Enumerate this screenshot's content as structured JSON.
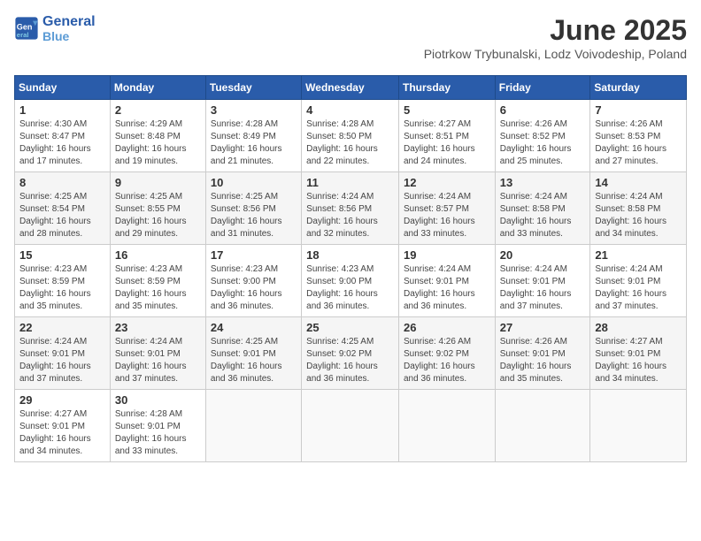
{
  "header": {
    "logo_line1": "General",
    "logo_line2": "Blue",
    "month_title": "June 2025",
    "location": "Piotrkow Trybunalski, Lodz Voivodeship, Poland"
  },
  "columns": [
    "Sunday",
    "Monday",
    "Tuesday",
    "Wednesday",
    "Thursday",
    "Friday",
    "Saturday"
  ],
  "weeks": [
    [
      {
        "day": "1",
        "info": "Sunrise: 4:30 AM\nSunset: 8:47 PM\nDaylight: 16 hours\nand 17 minutes."
      },
      {
        "day": "2",
        "info": "Sunrise: 4:29 AM\nSunset: 8:48 PM\nDaylight: 16 hours\nand 19 minutes."
      },
      {
        "day": "3",
        "info": "Sunrise: 4:28 AM\nSunset: 8:49 PM\nDaylight: 16 hours\nand 21 minutes."
      },
      {
        "day": "4",
        "info": "Sunrise: 4:28 AM\nSunset: 8:50 PM\nDaylight: 16 hours\nand 22 minutes."
      },
      {
        "day": "5",
        "info": "Sunrise: 4:27 AM\nSunset: 8:51 PM\nDaylight: 16 hours\nand 24 minutes."
      },
      {
        "day": "6",
        "info": "Sunrise: 4:26 AM\nSunset: 8:52 PM\nDaylight: 16 hours\nand 25 minutes."
      },
      {
        "day": "7",
        "info": "Sunrise: 4:26 AM\nSunset: 8:53 PM\nDaylight: 16 hours\nand 27 minutes."
      }
    ],
    [
      {
        "day": "8",
        "info": "Sunrise: 4:25 AM\nSunset: 8:54 PM\nDaylight: 16 hours\nand 28 minutes."
      },
      {
        "day": "9",
        "info": "Sunrise: 4:25 AM\nSunset: 8:55 PM\nDaylight: 16 hours\nand 29 minutes."
      },
      {
        "day": "10",
        "info": "Sunrise: 4:25 AM\nSunset: 8:56 PM\nDaylight: 16 hours\nand 31 minutes."
      },
      {
        "day": "11",
        "info": "Sunrise: 4:24 AM\nSunset: 8:56 PM\nDaylight: 16 hours\nand 32 minutes."
      },
      {
        "day": "12",
        "info": "Sunrise: 4:24 AM\nSunset: 8:57 PM\nDaylight: 16 hours\nand 33 minutes."
      },
      {
        "day": "13",
        "info": "Sunrise: 4:24 AM\nSunset: 8:58 PM\nDaylight: 16 hours\nand 33 minutes."
      },
      {
        "day": "14",
        "info": "Sunrise: 4:24 AM\nSunset: 8:58 PM\nDaylight: 16 hours\nand 34 minutes."
      }
    ],
    [
      {
        "day": "15",
        "info": "Sunrise: 4:23 AM\nSunset: 8:59 PM\nDaylight: 16 hours\nand 35 minutes."
      },
      {
        "day": "16",
        "info": "Sunrise: 4:23 AM\nSunset: 8:59 PM\nDaylight: 16 hours\nand 35 minutes."
      },
      {
        "day": "17",
        "info": "Sunrise: 4:23 AM\nSunset: 9:00 PM\nDaylight: 16 hours\nand 36 minutes."
      },
      {
        "day": "18",
        "info": "Sunrise: 4:23 AM\nSunset: 9:00 PM\nDaylight: 16 hours\nand 36 minutes."
      },
      {
        "day": "19",
        "info": "Sunrise: 4:24 AM\nSunset: 9:01 PM\nDaylight: 16 hours\nand 36 minutes."
      },
      {
        "day": "20",
        "info": "Sunrise: 4:24 AM\nSunset: 9:01 PM\nDaylight: 16 hours\nand 37 minutes."
      },
      {
        "day": "21",
        "info": "Sunrise: 4:24 AM\nSunset: 9:01 PM\nDaylight: 16 hours\nand 37 minutes."
      }
    ],
    [
      {
        "day": "22",
        "info": "Sunrise: 4:24 AM\nSunset: 9:01 PM\nDaylight: 16 hours\nand 37 minutes."
      },
      {
        "day": "23",
        "info": "Sunrise: 4:24 AM\nSunset: 9:01 PM\nDaylight: 16 hours\nand 37 minutes."
      },
      {
        "day": "24",
        "info": "Sunrise: 4:25 AM\nSunset: 9:01 PM\nDaylight: 16 hours\nand 36 minutes."
      },
      {
        "day": "25",
        "info": "Sunrise: 4:25 AM\nSunset: 9:02 PM\nDaylight: 16 hours\nand 36 minutes."
      },
      {
        "day": "26",
        "info": "Sunrise: 4:26 AM\nSunset: 9:02 PM\nDaylight: 16 hours\nand 36 minutes."
      },
      {
        "day": "27",
        "info": "Sunrise: 4:26 AM\nSunset: 9:01 PM\nDaylight: 16 hours\nand 35 minutes."
      },
      {
        "day": "28",
        "info": "Sunrise: 4:27 AM\nSunset: 9:01 PM\nDaylight: 16 hours\nand 34 minutes."
      }
    ],
    [
      {
        "day": "29",
        "info": "Sunrise: 4:27 AM\nSunset: 9:01 PM\nDaylight: 16 hours\nand 34 minutes."
      },
      {
        "day": "30",
        "info": "Sunrise: 4:28 AM\nSunset: 9:01 PM\nDaylight: 16 hours\nand 33 minutes."
      },
      {
        "day": "",
        "info": ""
      },
      {
        "day": "",
        "info": ""
      },
      {
        "day": "",
        "info": ""
      },
      {
        "day": "",
        "info": ""
      },
      {
        "day": "",
        "info": ""
      }
    ]
  ]
}
